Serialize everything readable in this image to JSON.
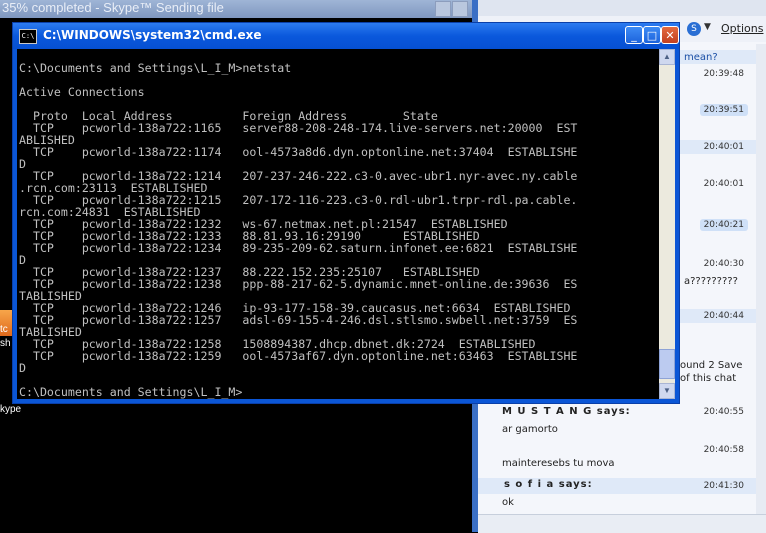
{
  "background_window": {
    "title": "35% completed - Skype™ Sending file"
  },
  "left_fragments": {
    "line1": "tc",
    "line2": "sh",
    "line3": "kype"
  },
  "cmd": {
    "title": "C:\\WINDOWS\\system32\\cmd.exe",
    "icon_text": "C:\\",
    "minimize": "_",
    "maximize": "□",
    "close": "✕",
    "lines": [
      "C:\\Documents and Settings\\L_I_M>netstat",
      "",
      "Active Connections",
      "",
      "  Proto  Local Address          Foreign Address        State",
      "  TCP    pcworld-138a722:1165   server88-208-248-174.live-servers.net:20000  EST",
      "ABLISHED",
      "  TCP    pcworld-138a722:1174   ool-4573a8d6.dyn.optonline.net:37404  ESTABLISHE",
      "D",
      "  TCP    pcworld-138a722:1214   207-237-246-222.c3-0.avec-ubr1.nyr-avec.ny.cable",
      ".rcn.com:23113  ESTABLISHED",
      "  TCP    pcworld-138a722:1215   207-172-116-223.c3-0.rdl-ubr1.trpr-rdl.pa.cable.",
      "rcn.com:24831  ESTABLISHED",
      "  TCP    pcworld-138a722:1232   ws-67.netmax.net.pl:21547  ESTABLISHED",
      "  TCP    pcworld-138a722:1233   88.81.93.16:29190      ESTABLISHED",
      "  TCP    pcworld-138a722:1234   89-235-209-62.saturn.infonet.ee:6821  ESTABLISHE",
      "D",
      "  TCP    pcworld-138a722:1237   88.222.152.235:25107   ESTABLISHED",
      "  TCP    pcworld-138a722:1238   ppp-88-217-62-5.dynamic.mnet-online.de:39636  ES",
      "TABLISHED",
      "  TCP    pcworld-138a722:1246   ip-93-177-158-39.caucasus.net:6634  ESTABLISHED",
      "  TCP    pcworld-138a722:1257   adsl-69-155-4-246.dsl.stlsmo.swbell.net:3759  ES",
      "TABLISHED",
      "  TCP    pcworld-138a722:1258   1508894387.dhcp.dbnet.dk:2724  ESTABLISHED",
      "  TCP    pcworld-138a722:1259   ool-4573af67.dyn.optonline.net:63463  ESTABLISHE",
      "D",
      "",
      "C:\\Documents and Settings\\L_I_M>"
    ]
  },
  "chat": {
    "options_label": "Options",
    "fragment_mean": "mean?",
    "fragment_question": "a?????????",
    "fragment_save1": "ound 2 Save",
    "fragment_save2": "of this chat",
    "timestamps": [
      "20:39:48",
      "20:39:51",
      "20:40:01",
      "20:40:01",
      "20:40:21",
      "20:40:30",
      "20:40:44"
    ],
    "messages": [
      {
        "sender": "M U S T A N G says:",
        "time": "20:40:55",
        "text": "ar gamorto"
      },
      {
        "sender": "",
        "time": "20:40:58",
        "text": "mainteresebs tu mova"
      },
      {
        "sender": "s o f i a  says:",
        "time": "20:41:30",
        "text": "ok"
      }
    ]
  }
}
